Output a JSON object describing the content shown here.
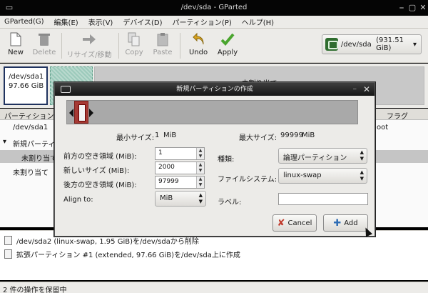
{
  "window": {
    "title": "/dev/sda - GParted"
  },
  "menu": [
    "GParted(G)",
    "編集(E)",
    "表示(V)",
    "デバイス(D)",
    "パーティション(P)",
    "ヘルプ(H)"
  ],
  "toolbar": {
    "new": "New",
    "delete": "Delete",
    "resize": "リサイズ/移動",
    "copy": "Copy",
    "paste": "Paste",
    "undo": "Undo",
    "apply": "Apply"
  },
  "device": {
    "name": "/dev/sda",
    "size": "(931.51 GiB)"
  },
  "graph": {
    "p1_name": "/dev/sda1",
    "p1_size": "97.66 GiB",
    "unalloc": "未割り当て"
  },
  "list": {
    "headers": {
      "partition": "パーティション",
      "flags": "フラグ"
    },
    "rows": [
      {
        "name": "/dev/sda1",
        "extra": "oot"
      },
      {
        "name": "新規パーティ"
      },
      {
        "name": "未割り当て"
      },
      {
        "name": "未割り当て"
      }
    ]
  },
  "dialog": {
    "title": "新規パーティションの作成",
    "min_label": "最小サイズ:",
    "min_value": "1",
    "min_unit": "MiB",
    "max_label": "最大サイズ:",
    "max_value": "99999",
    "max_unit": "MiB",
    "preceding_label": "前方の空き領域 (MiB):",
    "preceding_value": "1",
    "newsize_label": "新しいサイズ (MiB):",
    "newsize_value": "2000",
    "following_label": "後方の空き領域 (MiB):",
    "following_value": "97999",
    "align_label": "Align to:",
    "align_value": "MiB",
    "type_label": "種類:",
    "type_value": "論理パーティション",
    "fs_label": "ファイルシステム:",
    "fs_value": "linux-swap",
    "fslabel_label": "ラベル:",
    "fslabel_value": "",
    "cancel": "Cancel",
    "add": "Add"
  },
  "operations": [
    "/dev/sda2 (linux-swap, 1.95 GiB)を/dev/sdaから削除",
    "拡張パーティション #1 (extended, 97.66 GiB)を/dev/sda上に作成"
  ],
  "status": "2 件の操作を保留中"
}
